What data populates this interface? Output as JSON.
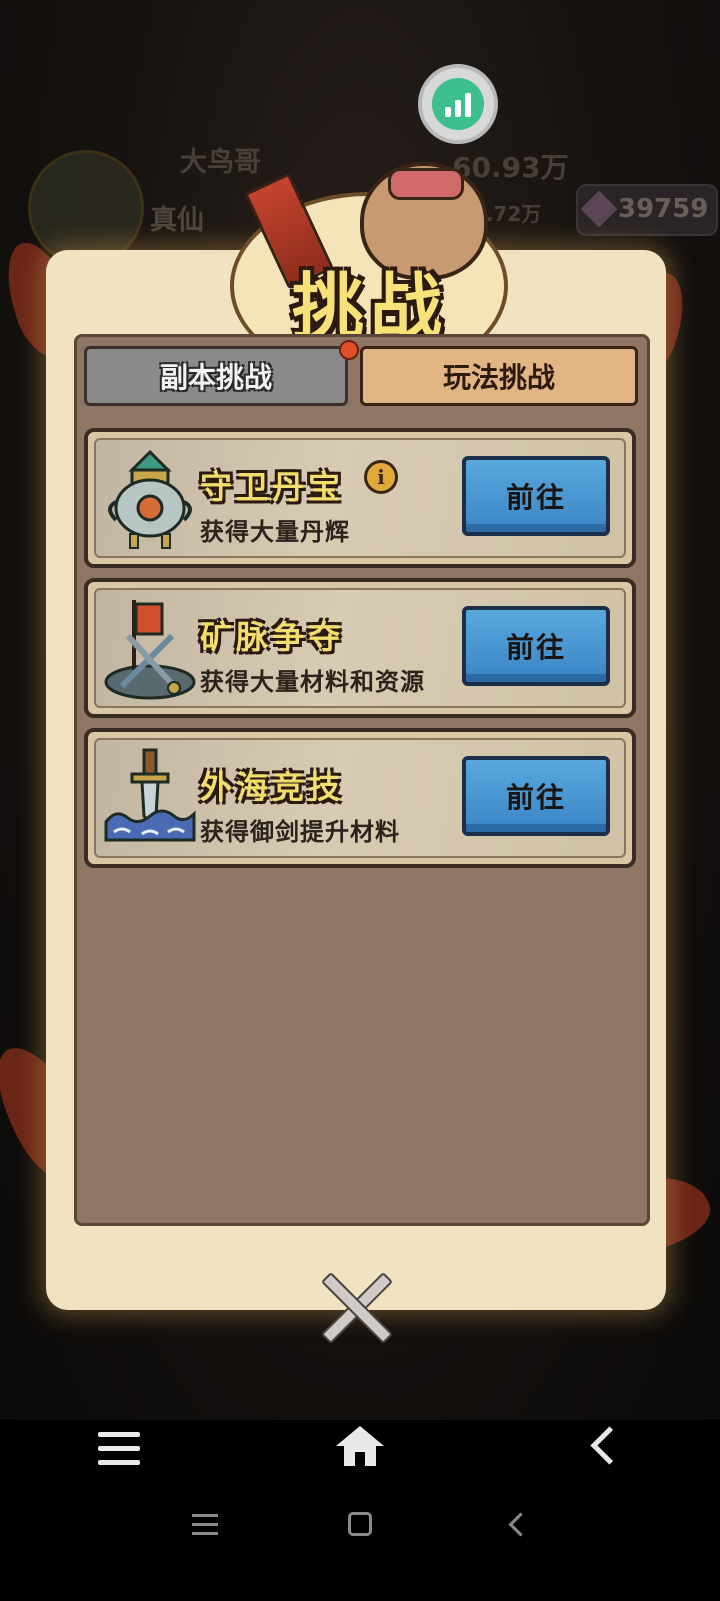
{
  "background": {
    "player_name": "大鸟哥",
    "realm": "真仙",
    "power_value": "60.93万",
    "power_secondary": "57.72万",
    "gem_count": "39759"
  },
  "dialog": {
    "title": "挑战",
    "tabs": [
      {
        "label": "副本挑战",
        "active": false,
        "has_notification": true
      },
      {
        "label": "玩法挑战",
        "active": true,
        "has_notification": false
      }
    ],
    "challenges": [
      {
        "title": "守卫丹宝",
        "description": "获得大量丹辉",
        "button_label": "前往",
        "has_info": true,
        "icon": "tripod-cauldron-icon"
      },
      {
        "title": "矿脉争夺",
        "description": "获得大量材料和资源",
        "button_label": "前往",
        "has_info": false,
        "icon": "mine-flag-icon"
      },
      {
        "title": "外海竞技",
        "description": "获得御剑提升材料",
        "button_label": "前往",
        "has_info": false,
        "icon": "sword-waves-icon"
      }
    ],
    "info_glyph": "i"
  },
  "colors": {
    "accent_blue": "#4a96d2",
    "tab_active": "#e2b585",
    "tab_inactive": "#8a8a8a",
    "title_yellow": "#f2de6e",
    "notification_red": "#e2502a"
  },
  "navigation": {
    "app_nav": [
      "menu-icon",
      "home-icon",
      "back-icon"
    ],
    "system_nav": [
      "recents-icon",
      "home-square-icon",
      "back-icon"
    ]
  }
}
